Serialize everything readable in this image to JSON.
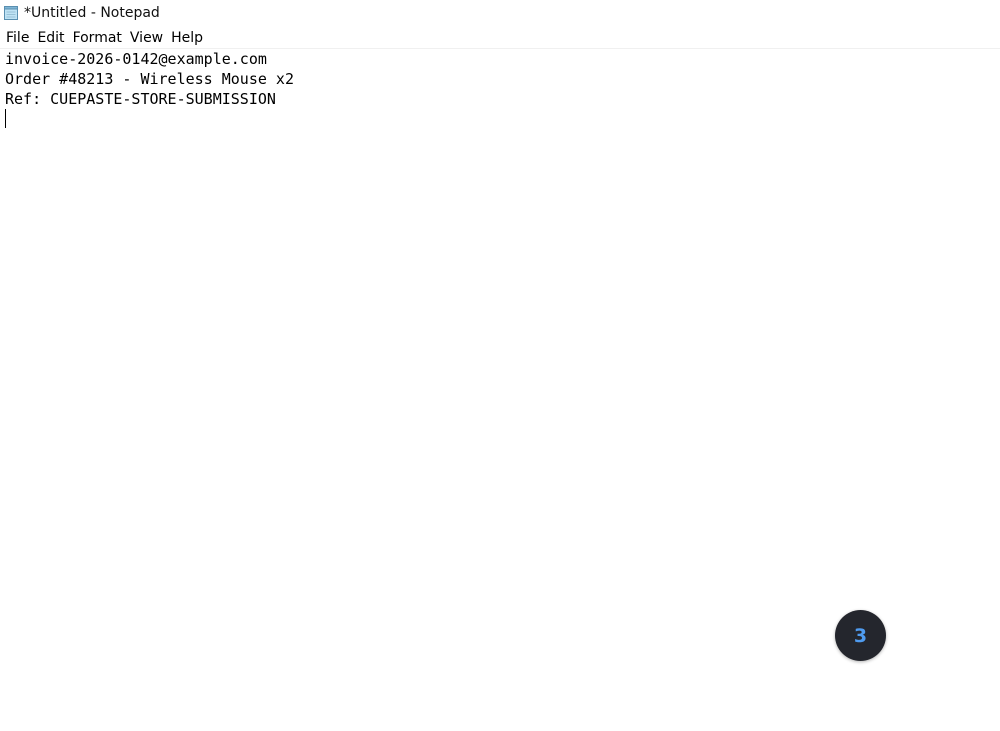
{
  "window": {
    "title": "*Untitled - Notepad",
    "icon": "notepad-icon"
  },
  "menu": {
    "items": [
      {
        "label": "File"
      },
      {
        "label": "Edit"
      },
      {
        "label": "Format"
      },
      {
        "label": "View"
      },
      {
        "label": "Help"
      }
    ]
  },
  "editor": {
    "lines": [
      "invoice-2026-0142@example.com",
      "Order #48213 - Wireless Mouse x2",
      "Ref: CUEPASTE-STORE-SUBMISSION"
    ]
  },
  "overlay": {
    "step_number": "3",
    "badge_color": "#24262d",
    "number_color": "#4f9bef"
  }
}
